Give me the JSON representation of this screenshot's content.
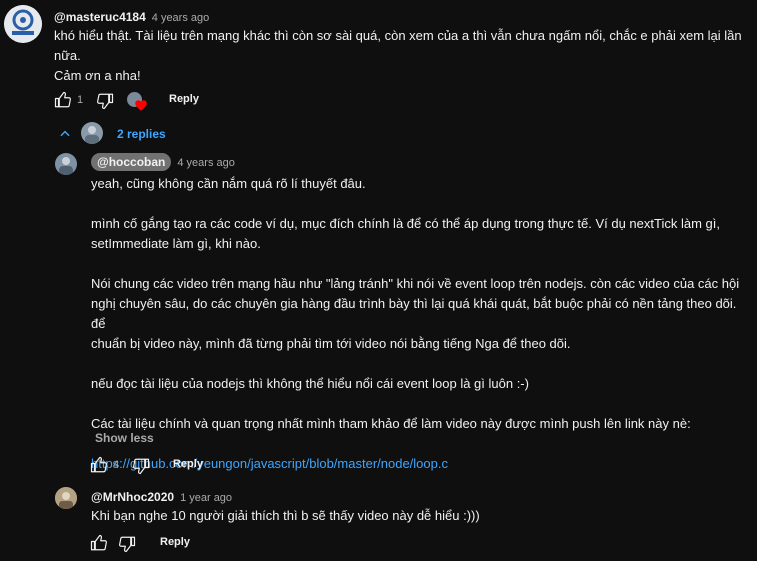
{
  "comment": {
    "author": "@masteruc4184",
    "time": "4 years ago",
    "line1": "khó hiểu thật. Tài liệu trên mạng khác thì còn sơ sài quá, còn xem của a thì vẫn chưa ngấm nổi, chắc e phải xem lại lần",
    "line2": "nữa.",
    "line3": "Cảm ơn a nha!",
    "likes": "1",
    "reply_label": "Reply",
    "replies_label": "2 replies"
  },
  "reply1": {
    "author": "@hoccoban",
    "time": "4 years ago",
    "p1": "yeah, cũng không cần nắm quá rõ lí thuyết đâu.",
    "p2a": "mình cố gắng tạo ra các code ví dụ, mục đích chính là để có thể áp dụng trong thực tế. Ví dụ nextTick làm gì,",
    "p2b": "setImmediate làm gì, khi nào.",
    "p3a": "Nói chung các video trên mạng hầu như \"lảng tránh\" khi nói về event loop trên nodejs. còn các video của các hội",
    "p3b": "nghị chuyên sâu, do các chuyên gia hàng đầu trình bày thì lại quá khái quát, bắt buộc phải có nền tảng theo dõi. để",
    "p3c": "chuẩn bị video này, mình đã từng phải tìm tới video nói bằng tiếng Nga để theo dõi.",
    "p4": "nếu đọc tài liệu của nodejs thì không thể hiểu nổi cái event loop là gì luôn :-)",
    "p5": "Các tài liệu chính và quan trọng nhất mình tham khảo để làm video này được mình push lên link này nè:",
    "link": "https://github.com/yeungon/javascript/blob/master/node/loop.c",
    "show_less": "Show less",
    "likes": "4",
    "reply_label": "Reply"
  },
  "reply2": {
    "author": "@MrNhoc2020",
    "time": "1 year ago",
    "text": "Khi bạn nghe 10 người giải thích thì b sẽ thấy video này dễ hiểu :)))",
    "reply_label": "Reply"
  },
  "icons": {
    "like": "thumb-up-icon",
    "dislike": "thumb-down-icon",
    "collapse": "chevron-up-icon",
    "heart": "heart-icon"
  },
  "colors": {
    "background": "#0f0f0f",
    "link": "#3ea6ff",
    "heart": "#ff0000"
  }
}
